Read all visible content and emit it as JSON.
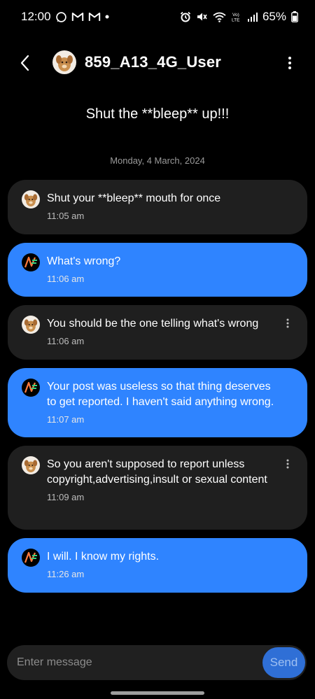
{
  "status_bar": {
    "time": "12:00",
    "battery": "65%",
    "left_icons": [
      "whatsapp-icon",
      "gmail-icon",
      "gmail-icon",
      "dot-icon"
    ],
    "right_icons": [
      "alarm-icon",
      "mute-icon",
      "wifi-icon",
      "volte-icon",
      "signal-icon",
      "battery-icon"
    ]
  },
  "header": {
    "title": "859_A13_4G_User"
  },
  "subject": "Shut the **bleep** up!!!",
  "date_separator": "Monday, 4 March, 2024",
  "messages": [
    {
      "direction": "received",
      "text": "Shut your **bleep** mouth for once",
      "time": "11:05 am"
    },
    {
      "direction": "sent",
      "text": "What's wrong?",
      "time": "11:06 am"
    },
    {
      "direction": "received",
      "text": "You should be the one telling what's wrong",
      "time": "11:06 am"
    },
    {
      "direction": "sent",
      "text": "Your post was useless so that thing deserves to get reported. I haven't said anything wrong.",
      "time": "11:07 am"
    },
    {
      "direction": "received",
      "text": "So you aren't supposed to report unless copyright,advertising,insult or sexual content",
      "time": "11:09 am"
    },
    {
      "direction": "sent",
      "text": "I will. I know my rights.",
      "time": "11:26 am"
    }
  ],
  "composer": {
    "placeholder": "Enter message",
    "send_label": "Send"
  },
  "colors": {
    "background": "#000000",
    "received_bubble": "#1f1f1f",
    "sent_bubble": "#2f84ff",
    "send_button": "#2f6fd6"
  }
}
